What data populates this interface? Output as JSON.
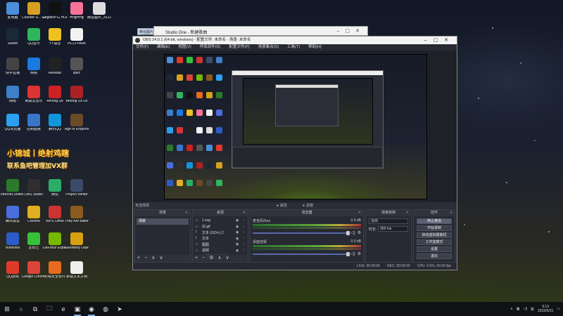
{
  "desktop": {
    "icons": [
      {
        "label": "此电脑",
        "color": "#4a8fd8"
      },
      {
        "label": "Steam",
        "color": "#1b2838"
      },
      {
        "label": "快手直播",
        "color": "#444"
      },
      {
        "label": "网络",
        "color": "#3d7fc8"
      },
      {
        "label": "QQ浏览器",
        "color": "#2aa1f0"
      },
      {
        "label": "Internet Downl...",
        "color": "#2a7a2a"
      },
      {
        "label": "腾讯会议",
        "color": "#4a6de0"
      },
      {
        "label": "Windows",
        "color": "#2b5cc9"
      },
      {
        "label": "QQ游戏",
        "color": "#e03a2a"
      },
      {
        "label": "Counter-S... Global Offe...",
        "color": "#d8a020"
      },
      {
        "label": "QQ音乐",
        "color": "#2fb65c"
      },
      {
        "label": "网络",
        "color": "#1a7adf"
      },
      {
        "label": "网易云音乐",
        "color": "#d33"
      },
      {
        "label": "控制面板",
        "color": "#3a75c8"
      },
      {
        "label": "OBS Studio",
        "color": "#302e31"
      },
      {
        "label": "Chrome",
        "color": "#e0b020"
      },
      {
        "label": "爱奇艺",
        "color": "#36c13a"
      },
      {
        "label": "Google Chrome",
        "color": "#db4437"
      },
      {
        "label": "Logitech G HUB",
        "color": "#111"
      },
      {
        "label": "YY语音",
        "color": "#f0c020"
      },
      {
        "label": "Release",
        "color": "#222"
      },
      {
        "label": "Among Us",
        "color": "#c22"
      },
      {
        "label": "腾讯QQ",
        "color": "#1296db"
      },
      {
        "label": "微信",
        "color": "#2aae67"
      },
      {
        "label": "WPS Office",
        "color": "#c33"
      },
      {
        "label": "GeForce Experience",
        "color": "#76b900"
      },
      {
        "label": "火绒安全软件",
        "color": "#e86a1c"
      },
      {
        "label": "哔哩哔哩",
        "color": "#fb7299"
      },
      {
        "label": "PICO PARK",
        "color": "#f2f2f2"
      },
      {
        "label": "spec",
        "color": "#555"
      },
      {
        "label": "Among Us Dx",
        "color": "#a22"
      },
      {
        "label": "Age of Empires IV",
        "color": "#6b4a2a"
      },
      {
        "label": "Project Winter",
        "color": "#3a4b6a"
      },
      {
        "label": "They Are Billions",
        "color": "#8a5a20"
      },
      {
        "label": "Geometry Dash",
        "color": "#d8a010"
      },
      {
        "label": "新建文本文档",
        "color": "#eee"
      },
      {
        "label": "微信图片_2022032...",
        "color": "#ddd"
      }
    ],
    "banner": {
      "line1": "小锦城丨绝射鸡瞎",
      "line2": "联系鱼吧管理加VX群"
    }
  },
  "background_windows": {
    "studio_one": {
      "title": "Studio One - 新建歌曲"
    },
    "image_viewer": {
      "title": "微信图片_2022032..."
    }
  },
  "obs": {
    "title": "OBS 24.0.1 (64-bit, windows) - 配置文件: 未命名 - 场景: 未命名",
    "menu": [
      "文件(F)",
      "编辑(E)",
      "视图(V)",
      "停靠部件(D)",
      "配置文件(P)",
      "场景集合(S)",
      "工具(T)",
      "帮助(H)"
    ],
    "preview_bar": {
      "left": "未选择源",
      "mid1": "属性",
      "mid2": "滤镜"
    },
    "scenes": {
      "header": "场景",
      "items": [
        "场景"
      ]
    },
    "sources": {
      "header": "来源",
      "items": [
        {
          "name": "1.svg",
          "icon": "▭"
        },
        {
          "name": "白.gif",
          "icon": "▭"
        },
        {
          "name": "文本 (GDI+) 2",
          "icon": "T"
        },
        {
          "name": "文本",
          "icon": "T"
        },
        {
          "name": "图图",
          "icon": "▭"
        },
        {
          "name": "视频",
          "icon": "▭"
        },
        {
          "name": "音频输出捕获设备",
          "icon": "♪"
        }
      ]
    },
    "mixer": {
      "header": "混音器",
      "channels": [
        {
          "name": "麦克风/Aux",
          "db": "0.0 dB"
        },
        {
          "name": "桌面音频",
          "db": "0.0 dB"
        }
      ]
    },
    "transitions": {
      "header": "场景转换",
      "type": "淡出",
      "duration_label": "时长",
      "duration": "300 ms"
    },
    "controls": {
      "header": "控件",
      "buttons": [
        "停止推流",
        "开始录制",
        "启动虚拟摄像机",
        "工作室模式",
        "设置",
        "退出"
      ]
    },
    "status": {
      "live": "LIVE: 00:00:00",
      "rec": "REC: 00:00:00",
      "cpu": "CPU: 0.6%, 60.00 fps"
    }
  },
  "taskbar": {
    "start": "⊞",
    "search": "○",
    "taskview": "⧉",
    "apps": [
      "🗀",
      "e",
      "▣",
      "◉",
      "◍",
      "➤"
    ],
    "tray": {
      "lang": "拼",
      "time": "9:13",
      "date": "2022/6/21"
    }
  }
}
